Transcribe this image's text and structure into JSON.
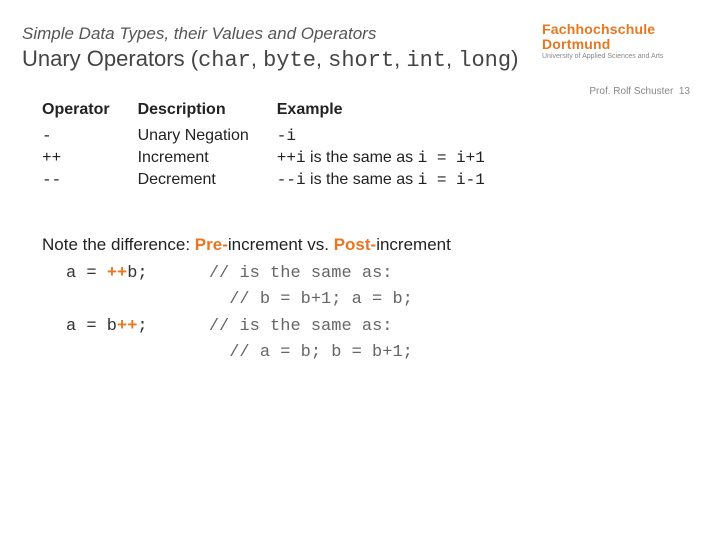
{
  "header": {
    "subtitle": "Simple Data Types, their Values and Operators",
    "title_lead": "Unary Operators (",
    "types": "char, byte, short, int, long",
    "title_tail": ")"
  },
  "brand": {
    "line1": "Fachhochschule",
    "line2": "Dortmund",
    "sub": "University of Applied Sciences and Arts"
  },
  "footer": {
    "author": "Prof. Rolf Schuster",
    "page": "13"
  },
  "table": {
    "h1": "Operator",
    "h2": "Description",
    "h3": "Example",
    "rows": [
      {
        "op": "-",
        "desc": "Unary Negation",
        "ex_code": "-i",
        "ex_rest": ""
      },
      {
        "op": "++",
        "desc": "Increment",
        "ex_code": "++i",
        "ex_rest": " is the same as ",
        "ex_tail": "i = i+1"
      },
      {
        "op": "--",
        "desc": "Decrement",
        "ex_code": "--i",
        "ex_rest": " is the same as ",
        "ex_tail": "i = i-1"
      }
    ]
  },
  "note": {
    "lead": "Note the difference: ",
    "pre": "Pre-",
    "mid": "increment vs. ",
    "post": "Post-",
    "tail": "increment"
  },
  "code": {
    "l1a": "a = ",
    "l1b": "++",
    "l1c": "b;      ",
    "l1d": "// is the same as:",
    "l2": "                // b = b+1; a = b;",
    "l3a": "a = b",
    "l3b": "++",
    "l3c": ";      ",
    "l3d": "// is the same as:",
    "l4": "                // a = b; b = b+1;"
  }
}
